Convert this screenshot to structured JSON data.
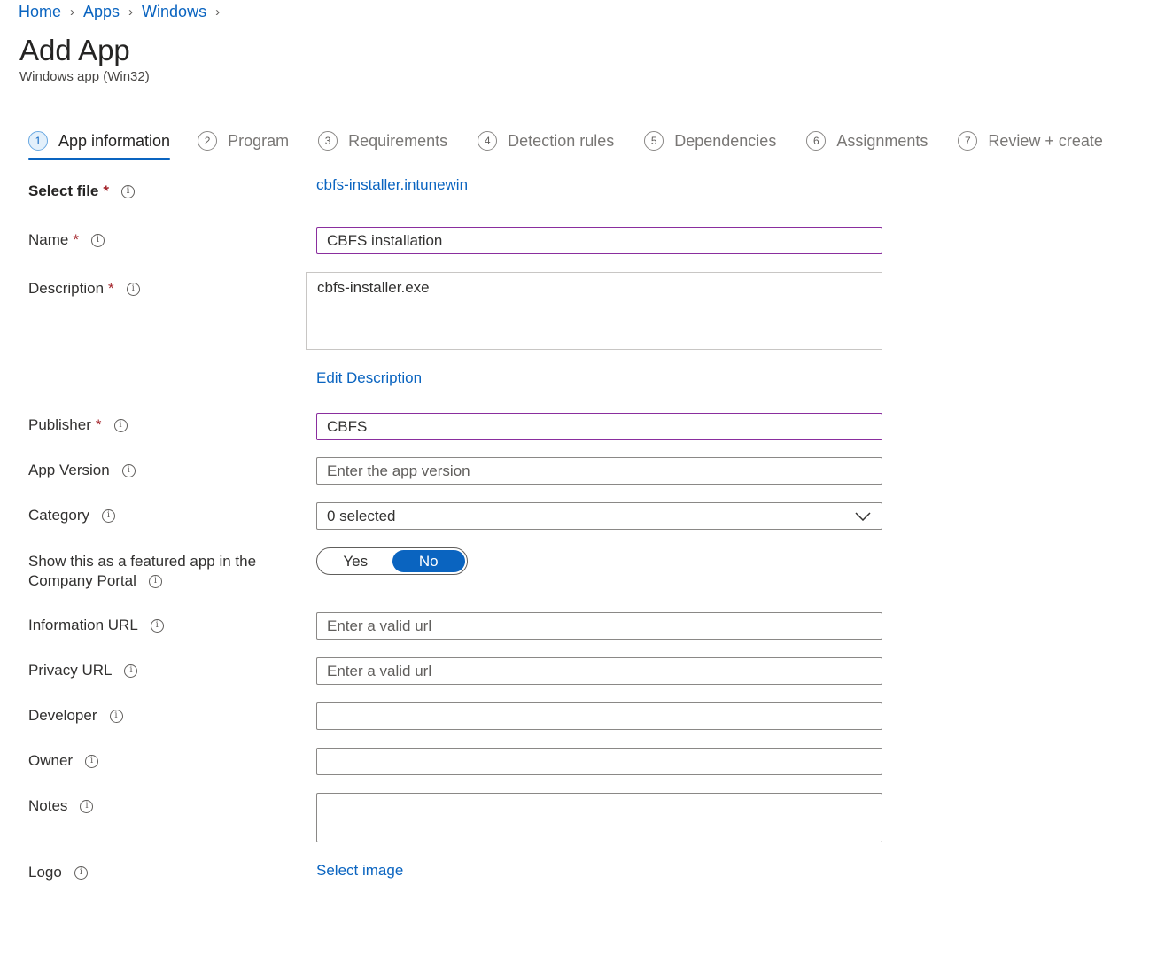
{
  "breadcrumb": [
    "Home",
    "Apps",
    "Windows"
  ],
  "page": {
    "title": "Add App",
    "subtitle": "Windows app (Win32)"
  },
  "steps": [
    {
      "num": "1",
      "label": "App information",
      "active": true
    },
    {
      "num": "2",
      "label": "Program"
    },
    {
      "num": "3",
      "label": "Requirements"
    },
    {
      "num": "4",
      "label": "Detection rules"
    },
    {
      "num": "5",
      "label": "Dependencies"
    },
    {
      "num": "6",
      "label": "Assignments"
    },
    {
      "num": "7",
      "label": "Review + create"
    }
  ],
  "labels": {
    "select_file": "Select file",
    "name": "Name",
    "description": "Description",
    "publisher": "Publisher",
    "app_version": "App Version",
    "category": "Category",
    "featured_line1": "Show this as a featured app in the",
    "featured_line2": "Company Portal",
    "information_url": "Information URL",
    "privacy_url": "Privacy URL",
    "developer": "Developer",
    "owner": "Owner",
    "notes": "Notes",
    "logo": "Logo"
  },
  "required_mark": "*",
  "info_glyph": "i",
  "values": {
    "file_link": "cbfs-installer.intunewin",
    "name": "CBFS installation",
    "description": "cbfs-installer.exe",
    "edit_description": "Edit Description",
    "publisher": "CBFS",
    "category": "0 selected",
    "select_image": "Select image",
    "developer": "",
    "owner": ""
  },
  "placeholders": {
    "app_version": "Enter the app version",
    "information_url": "Enter a valid url",
    "privacy_url": "Enter a valid url"
  },
  "toggle": {
    "yes": "Yes",
    "no": "No",
    "selected": "No"
  },
  "colors": {
    "link": "#0a64c0",
    "accent": "#0a64c0",
    "focus_border": "#8a2e9e",
    "required": "#a4262c"
  }
}
